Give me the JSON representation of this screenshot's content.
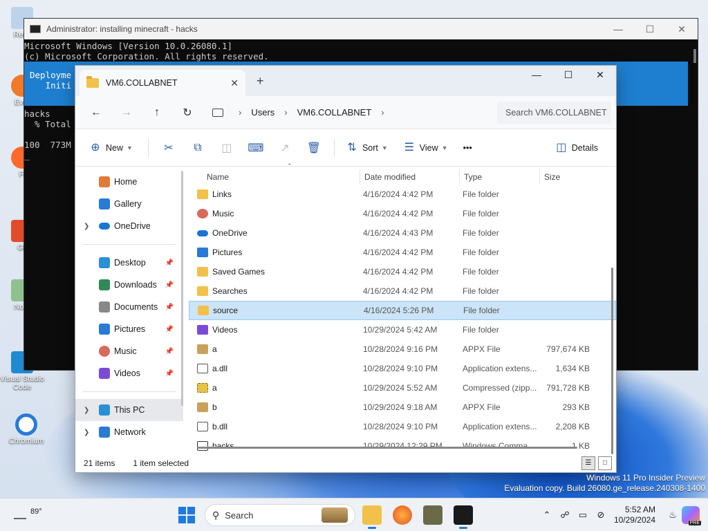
{
  "desktop": {
    "icons": [
      {
        "label": "Recy"
      },
      {
        "label": "Ever"
      },
      {
        "label": "Fi"
      },
      {
        "label": "Git"
      },
      {
        "label": "Note"
      },
      {
        "label": "Visual Studio Code"
      },
      {
        "label": "Chromium"
      }
    ],
    "watermark": {
      "line1": "Windows 11 Pro Insider Preview",
      "line2": "Evaluation copy. Build 26080.ge_release.240308-1400"
    }
  },
  "terminal": {
    "title": "Administrator: installing minecraft - hacks",
    "lines": [
      "Microsoft Windows [Version 10.0.26080.1]",
      "(c) Microsoft Corporation. All rights reserved."
    ],
    "banner": {
      "line1": "Deployme",
      "line2": "   Initi"
    },
    "lines_after": [
      "hacks",
      "  % Total",
      "",
      "100  773M",
      "_"
    ]
  },
  "explorer": {
    "tab_title": "VM6.COLLABNET",
    "breadcrumbs": [
      "Users",
      "VM6.COLLABNET"
    ],
    "search_placeholder": "Search VM6.COLLABNET",
    "commands": {
      "new": "New",
      "sort": "Sort",
      "view": "View",
      "more": "•••",
      "details": "Details"
    },
    "nav": {
      "top": [
        {
          "label": "Home",
          "color": "#e07b39"
        },
        {
          "label": "Gallery",
          "color": "#2a7ad6"
        },
        {
          "label": "OneDrive",
          "color": "#1976d2"
        }
      ],
      "quick": [
        {
          "label": "Desktop",
          "color": "#2a8fd6"
        },
        {
          "label": "Downloads",
          "color": "#2e8b57"
        },
        {
          "label": "Documents",
          "color": "#888888"
        },
        {
          "label": "Pictures",
          "color": "#2a7ad6"
        },
        {
          "label": "Music",
          "color": "#d96a5a"
        },
        {
          "label": "Videos",
          "color": "#7b4bd8"
        }
      ],
      "bottom": [
        {
          "label": "This PC",
          "color": "#2a8fd6"
        },
        {
          "label": "Network",
          "color": "#2a7ad6"
        }
      ]
    },
    "columns": {
      "name": "Name",
      "date": "Date modified",
      "type": "Type",
      "size": "Size"
    },
    "files": [
      {
        "name": "Links",
        "date": "4/16/2024 4:42 PM",
        "type": "File folder",
        "size": "",
        "icon": "folder"
      },
      {
        "name": "Music",
        "date": "4/16/2024 4:42 PM",
        "type": "File folder",
        "size": "",
        "icon": "music"
      },
      {
        "name": "OneDrive",
        "date": "4/16/2024 4:43 PM",
        "type": "File folder",
        "size": "",
        "icon": "onedrive"
      },
      {
        "name": "Pictures",
        "date": "4/16/2024 4:42 PM",
        "type": "File folder",
        "size": "",
        "icon": "pictures"
      },
      {
        "name": "Saved Games",
        "date": "4/16/2024 4:42 PM",
        "type": "File folder",
        "size": "",
        "icon": "folder"
      },
      {
        "name": "Searches",
        "date": "4/16/2024 4:42 PM",
        "type": "File folder",
        "size": "",
        "icon": "folder"
      },
      {
        "name": "source",
        "date": "4/16/2024 5:26 PM",
        "type": "File folder",
        "size": "",
        "icon": "folder",
        "selected": true
      },
      {
        "name": "Videos",
        "date": "10/29/2024 5:42 AM",
        "type": "File folder",
        "size": "",
        "icon": "videos"
      },
      {
        "name": "a",
        "date": "10/28/2024 9:16 PM",
        "type": "APPX File",
        "size": "797,674 KB",
        "icon": "appx"
      },
      {
        "name": "a.dll",
        "date": "10/28/2024 9:10 PM",
        "type": "Application extens...",
        "size": "1,634 KB",
        "icon": "dll"
      },
      {
        "name": "a",
        "date": "10/29/2024 5:52 AM",
        "type": "Compressed (zipp...",
        "size": "791,728 KB",
        "icon": "zip"
      },
      {
        "name": "b",
        "date": "10/29/2024 9:18 AM",
        "type": "APPX File",
        "size": "293 KB",
        "icon": "appx"
      },
      {
        "name": "b.dll",
        "date": "10/28/2024 9:10 PM",
        "type": "Application extens...",
        "size": "2,208 KB",
        "icon": "dll"
      },
      {
        "name": "hacks",
        "date": "10/29/2024 12:29 PM",
        "type": "Windows Comma...",
        "size": "1 KB",
        "icon": "cmd"
      }
    ],
    "status": {
      "items": "21 items",
      "selected": "1 item selected"
    }
  },
  "taskbar": {
    "weather": "89°",
    "search_label": "Search",
    "clock_time": "5:52 AM",
    "clock_date": "10/29/2024",
    "copilot_badge": "PRE"
  }
}
